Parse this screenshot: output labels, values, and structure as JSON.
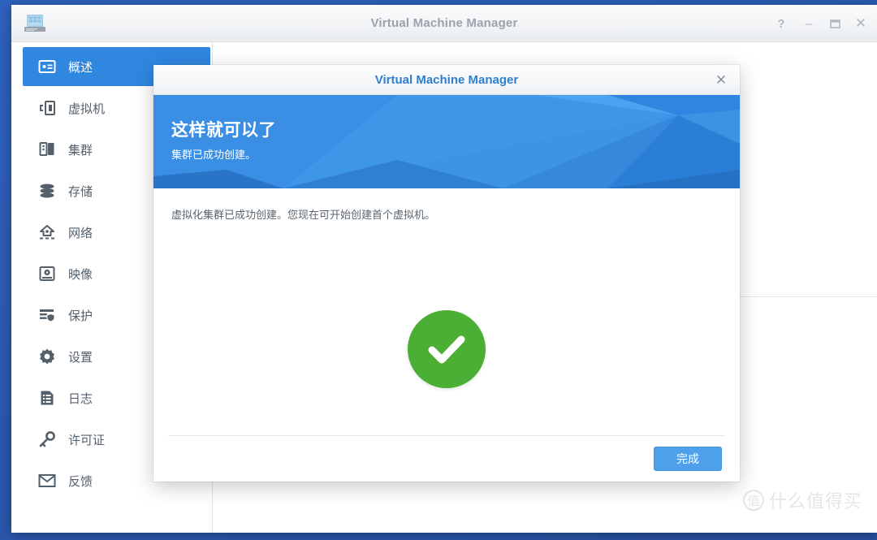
{
  "colors": {
    "desktop": "#2b59b0",
    "accent": "#2f87e0",
    "banner": "#2f87e0",
    "success": "#4caf35",
    "button": "#4fa0ea",
    "dialog_title": "#2f7fd0",
    "window_title": "#9aa3ad"
  },
  "window": {
    "title": "Virtual Machine Manager",
    "icon": "nas-server-icon",
    "controls": [
      {
        "name": "help-button",
        "glyph": "?",
        "label": "Help"
      },
      {
        "name": "minimize-button",
        "glyph": "–",
        "label": "Minimize"
      },
      {
        "name": "maximize-button",
        "glyph": "❐",
        "label": "Maximize"
      },
      {
        "name": "close-button",
        "glyph": "✕",
        "label": "Close"
      }
    ]
  },
  "sidebar": {
    "items": [
      {
        "label": "概述",
        "icon": "overview-card-icon",
        "active": true
      },
      {
        "label": "虚拟机",
        "icon": "virtual-machine-icon",
        "active": false
      },
      {
        "label": "集群",
        "icon": "cluster-icon",
        "active": false
      },
      {
        "label": "存储",
        "icon": "storage-database-icon",
        "active": false
      },
      {
        "label": "网络",
        "icon": "network-icon",
        "active": false
      },
      {
        "label": "映像",
        "icon": "image-disc-icon",
        "active": false
      },
      {
        "label": "保护",
        "icon": "protection-shield-icon",
        "active": false
      },
      {
        "label": "设置",
        "icon": "gear-icon",
        "active": false
      },
      {
        "label": "日志",
        "icon": "log-document-icon",
        "active": false
      },
      {
        "label": "许可证",
        "icon": "license-key-icon",
        "active": false
      },
      {
        "label": "反馈",
        "icon": "feedback-mail-icon",
        "active": false
      }
    ]
  },
  "dialog": {
    "title": "Virtual Machine Manager",
    "close_glyph": "✕",
    "banner": {
      "heading": "这样就可以了",
      "subheading": "集群已成功创建。"
    },
    "body": {
      "description": "虚拟化集群已成功创建。您现在可开始创建首个虚拟机。",
      "status_icon": "success-check-icon"
    },
    "footer": {
      "finish_label": "完成"
    }
  },
  "watermark": {
    "logo": "值",
    "text": "什么值得买"
  }
}
